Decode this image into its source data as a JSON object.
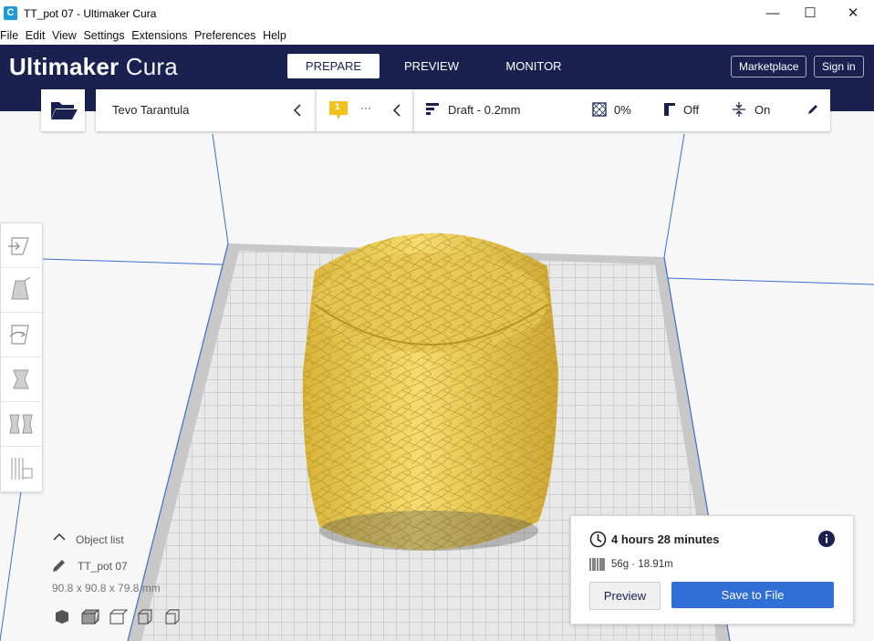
{
  "window": {
    "title": "TT_pot 07 - Ultimaker Cura",
    "app_icon": "C",
    "minimize": "—",
    "maximize": "☐",
    "close": "✕"
  },
  "menu": {
    "items": [
      "File",
      "Edit",
      "View",
      "Settings",
      "Extensions",
      "Preferences",
      "Help"
    ]
  },
  "header": {
    "logo_brand": "Ultimaker",
    "logo_product": "Cura",
    "stages": [
      "PREPARE",
      "PREVIEW",
      "MONITOR"
    ],
    "active_stage": "PREPARE",
    "marketplace": "Marketplace",
    "sign_in": "Sign in",
    "background_color": "#1a2150"
  },
  "printer": {
    "name": "Tevo Tarantula",
    "extruder_badge": "1",
    "material": "···"
  },
  "print_settings": {
    "profile": "Draft - 0.2mm",
    "infill": "0%",
    "support": "Off",
    "adhesion": "On"
  },
  "object": {
    "list_label": "Object list",
    "name": "TT_pot 07",
    "dimensions": "90.8 x 90.8 x 79.8 mm",
    "model_color": "#f3d45a"
  },
  "print_job": {
    "time": "4 hours 28 minutes",
    "material": "56g · 18.91m",
    "preview_button": "Preview",
    "save_button": "Save to File",
    "accent_color": "#2f6fd6"
  },
  "icons": {
    "open": "folder-icon",
    "tools": [
      "move-icon",
      "scale-icon",
      "rotate-icon",
      "mirror-icon",
      "per-model-settings-icon",
      "support-blocker-icon"
    ],
    "view_modes": [
      "3d-view-icon",
      "front-view-icon",
      "top-view-icon",
      "left-view-icon",
      "right-view-icon"
    ]
  }
}
